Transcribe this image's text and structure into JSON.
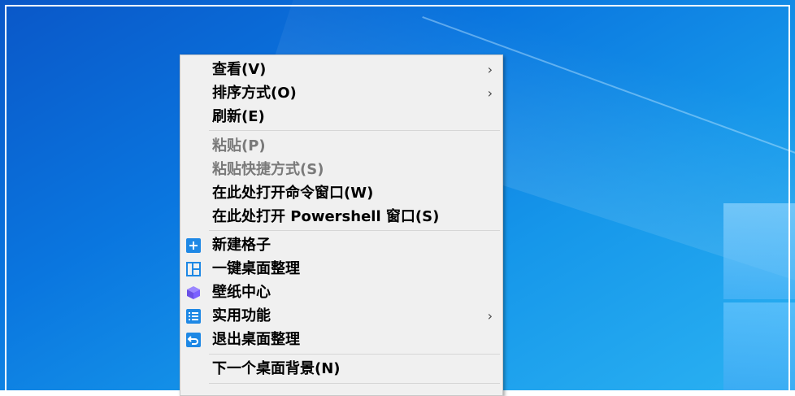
{
  "context_menu": {
    "items": [
      {
        "label": "查看(V)",
        "submenu": true,
        "enabled": true
      },
      {
        "label": "排序方式(O)",
        "submenu": true,
        "enabled": true
      },
      {
        "label": "刷新(E)",
        "submenu": false,
        "enabled": true
      },
      {
        "label": "粘贴(P)",
        "submenu": false,
        "enabled": false
      },
      {
        "label": "粘贴快捷方式(S)",
        "submenu": false,
        "enabled": false
      },
      {
        "label": "在此处打开命令窗口(W)",
        "submenu": false,
        "enabled": true
      },
      {
        "label": "在此处打开 Powershell 窗口(S)",
        "submenu": false,
        "enabled": true
      },
      {
        "label": "新建格子",
        "submenu": false,
        "enabled": true,
        "icon": "plus-icon"
      },
      {
        "label": "一键桌面整理",
        "submenu": false,
        "enabled": true,
        "icon": "layout-icon"
      },
      {
        "label": "壁纸中心",
        "submenu": false,
        "enabled": true,
        "icon": "cube-icon"
      },
      {
        "label": "实用功能",
        "submenu": true,
        "enabled": true,
        "icon": "list-icon"
      },
      {
        "label": "退出桌面整理",
        "submenu": false,
        "enabled": true,
        "icon": "exit-icon"
      },
      {
        "label": "下一个桌面背景(N)",
        "submenu": false,
        "enabled": true
      }
    ],
    "submenu_arrow": "›"
  },
  "colors": {
    "desktop_blue": "#0a76df",
    "menu_bg": "#f0f0f0",
    "icon_blue": "#1e88e5",
    "icon_purple": "#7b61ff"
  }
}
